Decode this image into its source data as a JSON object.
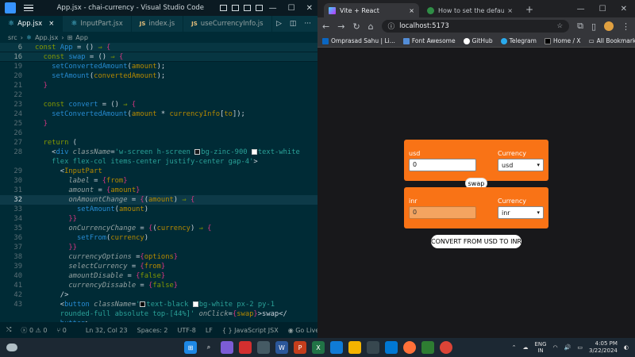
{
  "vscode": {
    "title": "App.jsx - chai-currency - Visual Studio Code",
    "tabs": [
      {
        "label": "App.jsx",
        "active": true,
        "icon": "react-icon"
      },
      {
        "label": "InputPart.jsx",
        "active": false,
        "icon": "react-icon"
      },
      {
        "label": "index.js",
        "active": false,
        "icon": "js-icon"
      },
      {
        "label": "useCurrencyInfo.js",
        "active": false,
        "icon": "js-icon"
      }
    ],
    "breadcrumb": {
      "folder": "src",
      "file": "App.jsx",
      "symbol": "App"
    },
    "status": {
      "errors": "0",
      "warnings": "0",
      "ports": "0",
      "position": "Ln 32, Col 23",
      "spaces": "Spaces: 2",
      "encoding": "UTF-8",
      "eol": "LF",
      "language": "JavaScript JSX",
      "golive": "Go Live"
    }
  },
  "code_lines": [
    {
      "n": "6",
      "text": "const App = () ⇒ {"
    },
    {
      "n": "16",
      "text": "  const swap = () ⇒ {"
    },
    {
      "n": "19",
      "text": "    setConvertedAmount(amount);"
    },
    {
      "n": "20",
      "text": "    setAmount(convertedAmount);"
    },
    {
      "n": "21",
      "text": "  }"
    },
    {
      "n": "22",
      "text": ""
    },
    {
      "n": "23",
      "text": "  const convert = () ⇒ {"
    },
    {
      "n": "24",
      "text": "    setConvertedAmount(amount * currencyInfo[to]);"
    },
    {
      "n": "25",
      "text": "  }"
    },
    {
      "n": "26",
      "text": ""
    },
    {
      "n": "27",
      "text": "  return ("
    },
    {
      "n": "28",
      "text": "    <div className='w-screen h-screen bg-zinc-900 text-white"
    },
    {
      "n": "",
      "text": "    flex flex-col items-center justify-center gap-4'>"
    },
    {
      "n": "29",
      "text": "      <InputPart"
    },
    {
      "n": "30",
      "text": "        label = {from}"
    },
    {
      "n": "31",
      "text": "        amount = {amount}"
    },
    {
      "n": "32",
      "text": "        onAmountChange = {(amount) ⇒ {"
    },
    {
      "n": "33",
      "text": "          setAmount(amount)"
    },
    {
      "n": "34",
      "text": "        }}"
    },
    {
      "n": "35",
      "text": "        onCurrencyChange = {(currency) ⇒ {"
    },
    {
      "n": "36",
      "text": "          setFrom(currency)"
    },
    {
      "n": "37",
      "text": "        }}"
    },
    {
      "n": "38",
      "text": "        currencyOptions ={options}"
    },
    {
      "n": "39",
      "text": "        selectCurrency = {from}"
    },
    {
      "n": "40",
      "text": "        amountDisable = {false}"
    },
    {
      "n": "41",
      "text": "        currencyDissable = {false}"
    },
    {
      "n": "42",
      "text": "      />"
    },
    {
      "n": "43",
      "text": "      <button className='text-black bg-white px-2 py-1"
    },
    {
      "n": "",
      "text": "      rounded-full absolute top-[44%]' onClick={swap}>swap</"
    },
    {
      "n": "",
      "text": "      button>"
    }
  ],
  "chrome": {
    "tabs": [
      {
        "label": "Vite + React",
        "active": true
      },
      {
        "label": "How to set the default value fo",
        "active": false
      }
    ],
    "url": "localhost:5173",
    "bookmarks": [
      "Omprasad Sahu | Li...",
      "Font Awesome",
      "GitHub",
      "Telegram",
      "Home / X"
    ],
    "all_bookmarks": "All Bookmarks"
  },
  "app": {
    "from_card": {
      "label": "usd",
      "currency_label": "Currency",
      "amount": "0",
      "currency": "usd"
    },
    "swap_label": "swap",
    "to_card": {
      "label": "inr",
      "currency_label": "Currency",
      "amount": "0",
      "currency": "inr"
    },
    "convert_label": "CONVERT FROM USD TO INR"
  },
  "taskbar": {
    "lang_top": "ENG",
    "lang_bottom": "IN",
    "time": "4:05 PM",
    "date": "3/22/2024"
  }
}
